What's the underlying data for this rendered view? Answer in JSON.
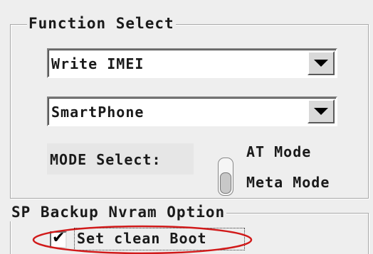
{
  "function_select": {
    "title": "Function Select",
    "function_combo": {
      "value": "Write IMEI"
    },
    "platform_combo": {
      "value": "SmartPhone"
    },
    "mode_select": {
      "label": "MODE Select:",
      "options": [
        "AT Mode",
        "Meta Mode"
      ],
      "selected": "Meta Mode"
    }
  },
  "sp_backup": {
    "title": "SP Backup Nvram Option",
    "clean_boot": {
      "label": "Set clean Boot",
      "checked": true
    }
  },
  "colors": {
    "window_bg": "#eeeeee",
    "highlight_ellipse": "#d11a1a"
  },
  "icons": [
    "chevron-down-icon",
    "checkmark-icon",
    "toggle-switch-icon"
  ]
}
